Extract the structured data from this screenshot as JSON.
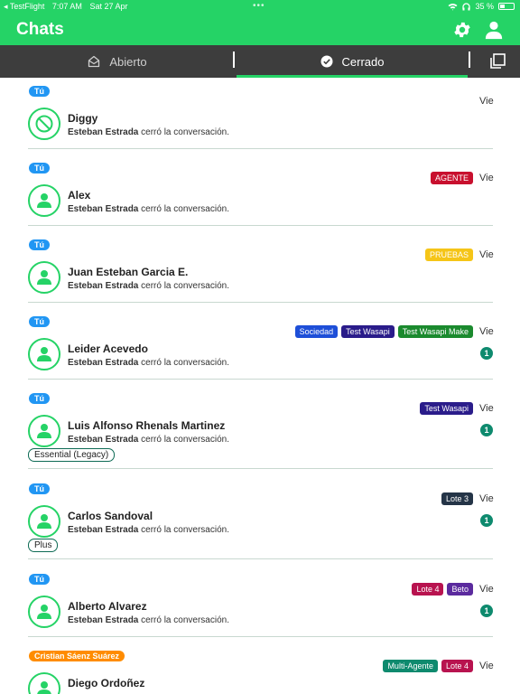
{
  "status_bar": {
    "back_app": "◂ TestFlight",
    "time": "7:07 AM",
    "date": "Sat 27 Apr",
    "battery": "35 %"
  },
  "header": {
    "title": "Chats"
  },
  "tabs": [
    {
      "label": "Abierto",
      "icon": "inbox-icon",
      "active": false
    },
    {
      "label": "Cerrado",
      "icon": "check-circle-icon",
      "active": true
    }
  ],
  "colors": {
    "brand_green": "#25d366",
    "tab_bar": "#3d3d3d",
    "you_pill": "#2196f3",
    "agent_pill": "#ff8c00",
    "unread": "#0e8a6e"
  },
  "chats": [
    {
      "assignee": "Tú",
      "name": "Diggy",
      "actor": "Esteban Estrada",
      "action": " cerró la conversación.",
      "date": "Vie",
      "tags": [],
      "unread": "",
      "plan": "",
      "avatar": "blocked-icon"
    },
    {
      "assignee": "Tú",
      "name": "Alex",
      "actor": "Esteban Estrada",
      "action": " cerró la conversación.",
      "date": "Vie",
      "tags": [
        {
          "label": "AGENTE",
          "color": "#c8102e"
        }
      ],
      "unread": "",
      "plan": "",
      "avatar": "person-icon"
    },
    {
      "assignee": "Tú",
      "name": "Juan Esteban Garcia E.",
      "actor": "Esteban Estrada",
      "action": " cerró la conversación.",
      "date": "Vie",
      "tags": [
        {
          "label": "PRUEBAS",
          "color": "#f5c518"
        }
      ],
      "unread": "",
      "plan": "",
      "avatar": "person-icon"
    },
    {
      "assignee": "Tú",
      "name": "Leider Acevedo",
      "actor": "Esteban Estrada",
      "action": " cerró la conversación.",
      "date": "Vie",
      "tags": [
        {
          "label": "Sociedad",
          "color": "#1e4fd8"
        },
        {
          "label": "Test Wasapi",
          "color": "#2a1c8a"
        },
        {
          "label": "Test Wasapi Make",
          "color": "#1b8a2e"
        }
      ],
      "unread": "1",
      "plan": "",
      "avatar": "person-icon"
    },
    {
      "assignee": "Tú",
      "name": "Luis Alfonso Rhenals Martinez",
      "actor": "Esteban Estrada",
      "action": " cerró la conversación.",
      "date": "Vie",
      "tags": [
        {
          "label": "Test Wasapi",
          "color": "#2a1c8a"
        }
      ],
      "unread": "1",
      "plan": "Essential (Legacy)",
      "avatar": "person-icon"
    },
    {
      "assignee": "Tú",
      "name": "Carlos Sandoval",
      "actor": "Esteban Estrada",
      "action": " cerró la conversación.",
      "date": "Vie",
      "tags": [
        {
          "label": "Lote 3",
          "color": "#243447"
        }
      ],
      "unread": "1",
      "plan": "Plus",
      "avatar": "person-icon"
    },
    {
      "assignee": "Tú",
      "name": "Alberto Alvarez",
      "actor": "Esteban Estrada",
      "action": " cerró la conversación.",
      "date": "Vie",
      "tags": [
        {
          "label": "Lote 4",
          "color": "#b8134f"
        },
        {
          "label": "Beto",
          "color": "#5b2a9e"
        }
      ],
      "unread": "1",
      "plan": "",
      "avatar": "person-icon"
    },
    {
      "assignee": "Cristian Sáenz Suárez",
      "name": "Diego Ordoñez",
      "actor": "",
      "action": "",
      "date": "Vie",
      "tags": [
        {
          "label": "Multi-Agente",
          "color": "#0e8a6e"
        },
        {
          "label": "Lote 4",
          "color": "#b8134f"
        }
      ],
      "unread": "",
      "plan": "",
      "avatar": "person-icon"
    }
  ]
}
